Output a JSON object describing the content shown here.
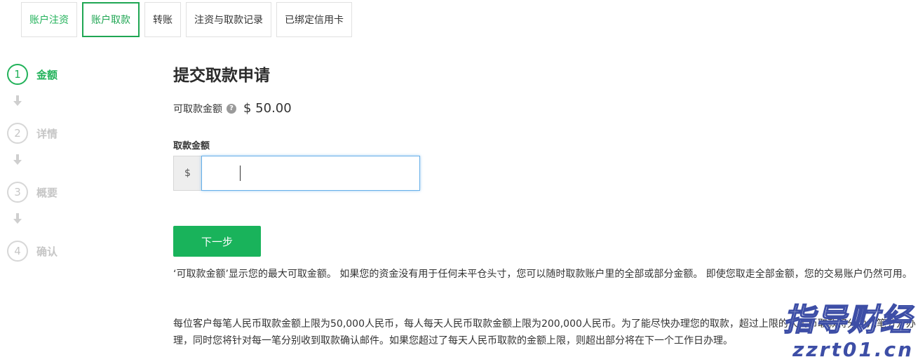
{
  "tabs": [
    {
      "label": "账户注资",
      "state": "green"
    },
    {
      "label": "账户取款",
      "state": "active"
    },
    {
      "label": "转账",
      "state": "normal"
    },
    {
      "label": "注资与取款记录",
      "state": "normal"
    },
    {
      "label": "已绑定信用卡",
      "state": "normal"
    }
  ],
  "steps": [
    {
      "number": "1",
      "label": "金额",
      "active": true
    },
    {
      "number": "2",
      "label": "详情",
      "active": false
    },
    {
      "number": "3",
      "label": "概要",
      "active": false
    },
    {
      "number": "4",
      "label": "确认",
      "active": false
    }
  ],
  "main": {
    "title": "提交取款申请",
    "available_label": "可取款金额",
    "help_icon": "?",
    "available_amount": "$ 50.00",
    "field_label": "取款金额",
    "currency_symbol": "$",
    "input_value": "",
    "next_button": "下一步",
    "paragraph1": "‘可取款金额’显示您的最大可取金额。 如果您的资金没有用于任何未平仓头寸，您可以随时取款账户里的全部或部分金额。 即使您取走全部金额，您的交易账户仍然可用。",
    "paragraph2": "每位客户每笔人民币取款金额上限为50,000人民币，每人每天人民币取款金额上限为200,000人民币。为了能尽快办理您的取款，超过上限的人民币取款将分为几笔分开办理，同时您将针对每一笔分别收到取款确认邮件。如果您超过了每天人民币取款的金额上限，则超出部分将在下一个工作日办理。"
  },
  "watermark": {
    "chinese": "指导财经",
    "url": "zzrt01.cn"
  },
  "colors": {
    "accent_green": "#19b35b",
    "input_focus_blue": "#66afe9",
    "watermark_blue": "#3d4ea6"
  }
}
